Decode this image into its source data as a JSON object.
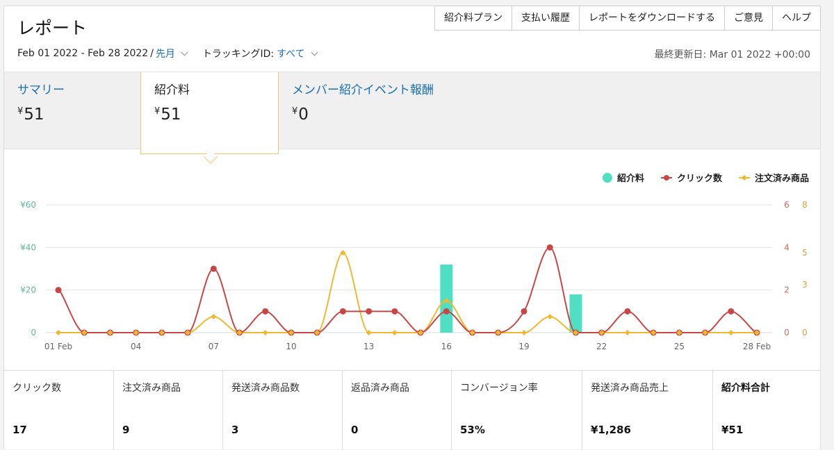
{
  "header": {
    "title": "レポート",
    "nav": [
      "紹介料プラン",
      "支払い履歴",
      "レポートをダウンロードする",
      "ご意見",
      "ヘルプ"
    ]
  },
  "filters": {
    "date_range": "Feb 01 2022 - Feb 28 2022",
    "separator": "/",
    "period": "先月",
    "tracking_label": "トラッキングID:",
    "tracking_value": "すべて",
    "last_updated": "最終更新日: Mar 01 2022 +00:00"
  },
  "tabs": [
    {
      "label": "サマリー",
      "currency": "¥",
      "amount": "51"
    },
    {
      "label": "紹介料",
      "currency": "¥",
      "amount": "51"
    },
    {
      "label": "メンバー紹介イベント報酬",
      "currency": "¥",
      "amount": "0"
    }
  ],
  "active_tab": 1,
  "colors": {
    "fees": "#4fe0c4",
    "clicks": "#c94646",
    "ordered": "#f0b830",
    "link": "#1a6fb0",
    "grid": "#e2e2e2"
  },
  "chart_data": {
    "type": "line",
    "legend": [
      "紹介料",
      "クリック数",
      "注文済み商品"
    ],
    "legend_position": "top-right",
    "x": [
      1,
      2,
      3,
      4,
      5,
      6,
      7,
      8,
      9,
      10,
      11,
      12,
      13,
      14,
      15,
      16,
      17,
      18,
      19,
      20,
      21,
      22,
      23,
      24,
      25,
      26,
      27,
      28
    ],
    "x_tick_labels": [
      {
        "x": 1,
        "label": "01 Feb"
      },
      {
        "x": 4,
        "label": "04"
      },
      {
        "x": 7,
        "label": "07"
      },
      {
        "x": 10,
        "label": "10"
      },
      {
        "x": 13,
        "label": "13"
      },
      {
        "x": 16,
        "label": "16"
      },
      {
        "x": 19,
        "label": "19"
      },
      {
        "x": 22,
        "label": "22"
      },
      {
        "x": 25,
        "label": "25"
      },
      {
        "x": 28,
        "label": "28 Feb"
      }
    ],
    "series": [
      {
        "name": "紹介料",
        "kind": "bar",
        "axis": "left",
        "values": [
          0,
          0,
          0,
          0,
          0,
          0,
          0,
          0,
          0,
          0,
          0,
          0,
          0,
          0,
          0,
          32,
          0,
          0,
          0,
          0,
          18,
          0,
          0,
          0,
          0,
          0,
          0,
          0
        ]
      },
      {
        "name": "クリック数",
        "kind": "line",
        "axis": "right1",
        "values": [
          2,
          0,
          0,
          0,
          0,
          0,
          3,
          0,
          1,
          0,
          0,
          1,
          1,
          1,
          0,
          1,
          0,
          0,
          1,
          4,
          0,
          0,
          1,
          0,
          0,
          0,
          1,
          0
        ]
      },
      {
        "name": "注文済み商品",
        "kind": "line",
        "axis": "right2",
        "values": [
          0,
          0,
          0,
          0,
          0,
          0,
          1,
          0,
          0,
          0,
          0,
          5,
          0,
          0,
          0,
          2,
          0,
          0,
          0,
          1,
          0,
          0,
          0,
          0,
          0,
          0,
          0,
          0
        ]
      }
    ],
    "y_left": {
      "range": [
        0,
        60
      ],
      "ticks": [
        "0",
        "¥20",
        "¥40",
        "¥60"
      ],
      "tick_values": [
        0,
        20,
        40,
        60
      ]
    },
    "y_right1": {
      "range": [
        0,
        6
      ],
      "ticks": [
        "0",
        "2",
        "4",
        "6"
      ],
      "tick_values": [
        0,
        2,
        4,
        6
      ]
    },
    "y_right2": {
      "range": [
        0,
        8
      ],
      "ticks": [
        "0",
        "3",
        "5",
        "8"
      ],
      "tick_values": [
        0,
        3,
        5,
        8
      ]
    },
    "grid": true
  },
  "stats": [
    {
      "label": "クリック数",
      "value": "17"
    },
    {
      "label": "注文済み商品",
      "value": "9"
    },
    {
      "label": "発送済み商品数",
      "value": "3"
    },
    {
      "label": "返品済み商品",
      "value": "0"
    },
    {
      "label": "コンバージョン率",
      "value": "53%"
    },
    {
      "label": "発送済み商品売上",
      "value": "¥1,286"
    },
    {
      "label": "紹介料合計",
      "value": "¥51"
    }
  ]
}
